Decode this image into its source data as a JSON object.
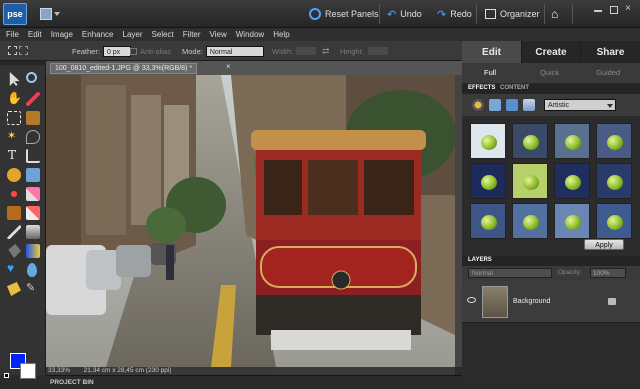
{
  "app": {
    "logo_text": "pse"
  },
  "topbar": {
    "reset_panels": "Reset Panels",
    "undo": "Undo",
    "redo": "Redo",
    "organizer": "Organizer"
  },
  "menu": [
    "File",
    "Edit",
    "Image",
    "Enhance",
    "Layer",
    "Select",
    "Filter",
    "View",
    "Window",
    "Help"
  ],
  "options": {
    "feather_label": "Feather:",
    "feather_value": "0 px",
    "antialias_label": "Anti-alias",
    "mode_label": "Mode:",
    "mode_value": "Normal",
    "width_label": "Width:",
    "height_label": "Height:"
  },
  "document": {
    "tab_label": "100_0810_edited-1.JPG @ 33,3%(RGB/8) *",
    "close": "×",
    "zoom": "33,33%",
    "size": "21,34 cm x 28,45 cm (230 ppi)"
  },
  "project_bin": "PROJECT BIN",
  "panel": {
    "tabs": [
      "Edit",
      "Create",
      "Share"
    ],
    "subtabs": [
      "Full",
      "Quick",
      "Guided"
    ],
    "effects_tab": "EFFECTS",
    "content_tab": "CONTENT",
    "effects_category": "Artistic",
    "apply": "Apply",
    "layers_tab": "LAYERS",
    "blend_mode": "Normal",
    "opacity_label": "Opacity:",
    "opacity_value": "100%",
    "layer_name": "Background"
  },
  "colors": {
    "accent": "#4da3ff",
    "foreground": "#0022ff",
    "background": "#ffffff"
  }
}
